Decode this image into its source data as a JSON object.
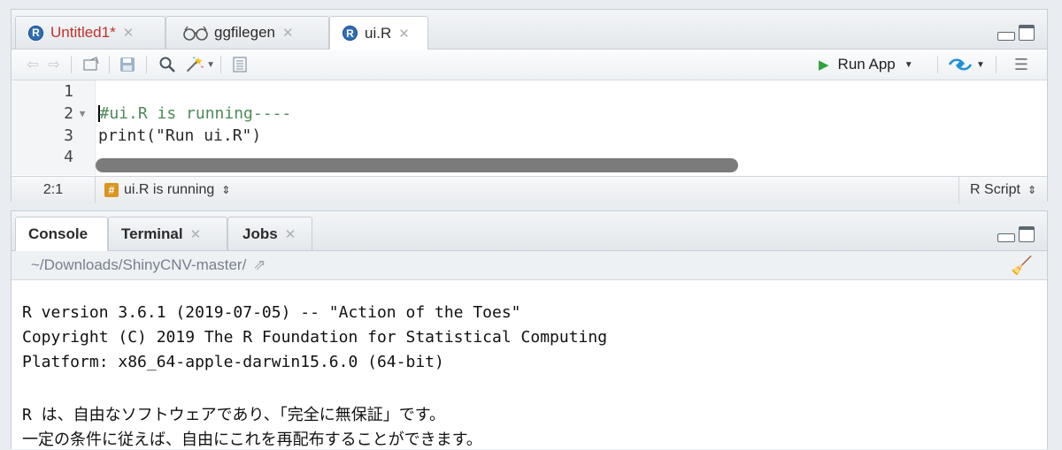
{
  "editor": {
    "tabs": [
      {
        "label": "Untitled1*",
        "icon": "r-file-icon"
      },
      {
        "label": "ggfilegen",
        "icon": "viewer-glasses-icon"
      },
      {
        "label": "ui.R",
        "icon": "r-file-icon"
      }
    ],
    "toolbar": {
      "run_app_label": "Run App"
    },
    "code_lines": [
      {
        "num": "1",
        "text": ""
      },
      {
        "num": "2",
        "text": "#ui.R is running----"
      },
      {
        "num": "3",
        "text": "print(\"Run ui.R\")"
      },
      {
        "num": "4",
        "text": ""
      }
    ],
    "status": {
      "position": "2:1",
      "section": "ui.R is running",
      "file_type": "R Script"
    }
  },
  "console": {
    "tabs": [
      {
        "label": "Console"
      },
      {
        "label": "Terminal"
      },
      {
        "label": "Jobs"
      }
    ],
    "path": "~/Downloads/ShinyCNV-master/",
    "output": [
      "R version 3.6.1 (2019-07-05) -- \"Action of the Toes\"",
      "Copyright (C) 2019 The R Foundation for Statistical Computing",
      "Platform: x86_64-apple-darwin15.6.0 (64-bit)",
      "R は、自由なソフトウェアであり、「完全に無保証」です。",
      "一定の条件に従えば、自由にこれを再配布することができます。"
    ]
  },
  "colors": {
    "accent_red": "#c0302a",
    "run_green": "#2fa33b",
    "comment_green": "#4e8a57",
    "r_logo_blue": "#2f6db5"
  }
}
